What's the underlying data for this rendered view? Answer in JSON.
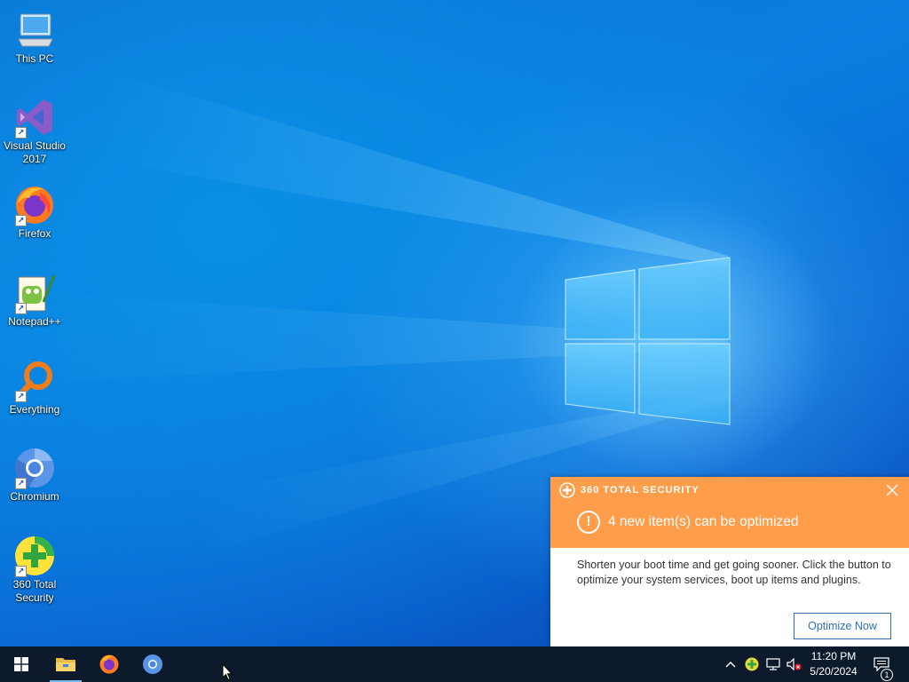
{
  "desktop": {
    "icons": [
      {
        "label": "This PC",
        "icon": "this-pc-icon",
        "shortcut": false
      },
      {
        "label": "Visual Studio\n2017",
        "icon": "visual-studio-icon",
        "shortcut": true
      },
      {
        "label": "Firefox",
        "icon": "firefox-icon",
        "shortcut": true
      },
      {
        "label": "Notepad++",
        "icon": "notepad-plus-plus-icon",
        "shortcut": true
      },
      {
        "label": "Everything",
        "icon": "everything-search-icon",
        "shortcut": true
      },
      {
        "label": "Chromium",
        "icon": "chromium-icon",
        "shortcut": true
      },
      {
        "label": "360 Total\nSecurity",
        "icon": "360-total-security-icon",
        "shortcut": true
      }
    ],
    "wallpaper": {
      "primary": "#0a78dc",
      "glow": "#5cc4ff"
    }
  },
  "popup": {
    "brand": "360 TOTAL SECURITY",
    "title": "4 new item(s) can be optimized",
    "body": "Shorten your boot time and get going sooner. Click the button to optimize your system services, boot up items and plugins.",
    "button_label": "Optimize Now",
    "header_color": "#ff9d4a",
    "accent_color": "#2f6db6"
  },
  "taskbar": {
    "start": "windows-start-icon",
    "apps": [
      {
        "name": "File Explorer",
        "icon": "file-explorer-icon",
        "active": true
      },
      {
        "name": "Firefox",
        "icon": "firefox-icon",
        "active": false
      },
      {
        "name": "Chromium",
        "icon": "chromium-icon",
        "active": false
      }
    ],
    "tray": {
      "icons": [
        "chevron-up-icon",
        "360-tray-icon",
        "network-icon",
        "volume-muted-icon"
      ],
      "time": "11:20 PM",
      "date": "5/20/2024",
      "notification_count": "1"
    },
    "background": "#0d1a2c"
  }
}
